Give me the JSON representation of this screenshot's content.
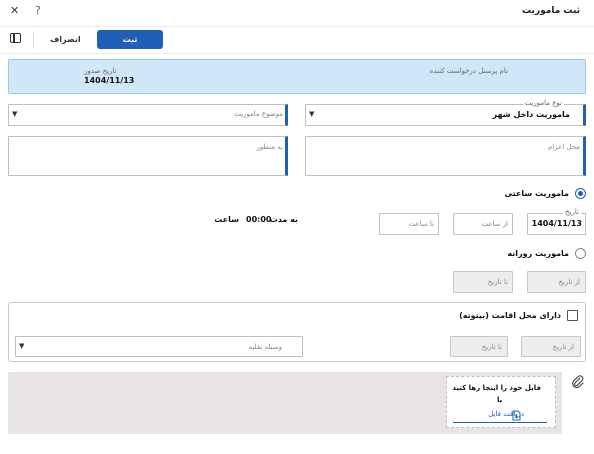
{
  "window": {
    "title": "ثبت ماموریت",
    "close_glyph": "✕",
    "help_glyph": "?"
  },
  "toolbar": {
    "submit_label": "ثبت",
    "cancel_label": "انصراف",
    "panel_icon": "sidebar-toggle-icon"
  },
  "info": {
    "requester_label": "نام پرسنل درخواست کننده",
    "requester_value": "",
    "issue_date_label": "تاریخ صدور",
    "issue_date_value": "1404/11/13"
  },
  "form": {
    "mission_type_label": "نوع ماموریت",
    "mission_type_value": "ماموریت داخل شهر",
    "mission_subject_placeholder": "موضوع ماموریت",
    "dispatch_place_placeholder": "محل اعزام",
    "purpose_placeholder": "به منظور"
  },
  "hourly": {
    "label": "ماموریت ساعتی",
    "date_label": "تاریخ",
    "date_value": "1404/11/13",
    "from_time_placeholder": "از ساعت",
    "to_time_placeholder": "تا ساعت",
    "duration_prefix": "به مدت",
    "duration_value": "00:00",
    "duration_unit": "ساعت"
  },
  "daily": {
    "label": "ماموریت روزانه",
    "from_date_placeholder": "از تاریخ",
    "to_date_placeholder": "تا تاریخ"
  },
  "accommodation": {
    "label": "دارای محل اقامت (بیتوته)",
    "from_date_placeholder": "از تاریخ",
    "to_date_placeholder": "تا تاریخ",
    "vehicle_placeholder": "وسیله نقلیه"
  },
  "upload": {
    "drop_text": "فایل خود را اینجا رها کنید",
    "or_text": "یا",
    "receive_link": "دریافت فایل"
  },
  "colors": {
    "accent": "#1f5fb8",
    "info_bg": "#cfe7f7",
    "upload_bg": "#e8e4e4"
  }
}
